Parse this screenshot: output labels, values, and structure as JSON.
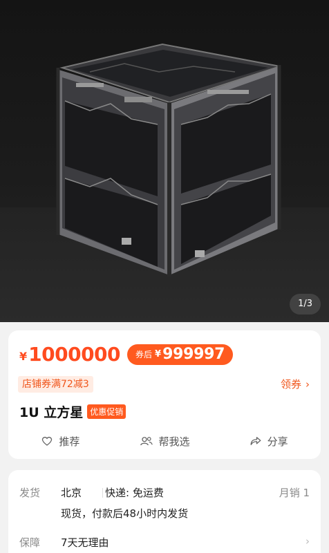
{
  "hero": {
    "image_alt": "cubesat product photo",
    "pager": "1/3"
  },
  "price": {
    "currency": "¥",
    "value": "1000000",
    "after_label": "券后",
    "after_currency": "¥",
    "after_value": "999997"
  },
  "coupon": {
    "text": "店铺券满72减3",
    "get_label": "领券",
    "get_icon": "chevron-right-icon"
  },
  "product": {
    "title": "1U 立方星",
    "promo_tag": "优惠促销"
  },
  "actions": [
    {
      "label": "推荐",
      "icon": "heart-icon"
    },
    {
      "label": "帮我选",
      "icon": "people-icon"
    },
    {
      "label": "分享",
      "icon": "share-icon"
    }
  ],
  "shipping": {
    "label": "发货",
    "city": "北京",
    "express": "快递: 免运费",
    "monthly_sales": "月销 1",
    "note": "现货，付款后48小时内发货"
  },
  "guarantee": {
    "label": "保障",
    "value": "7天无理由"
  },
  "colors": {
    "accent": "#ff5a1f",
    "price": "#ff4b1f",
    "coupon_bg": "#ffece3"
  }
}
